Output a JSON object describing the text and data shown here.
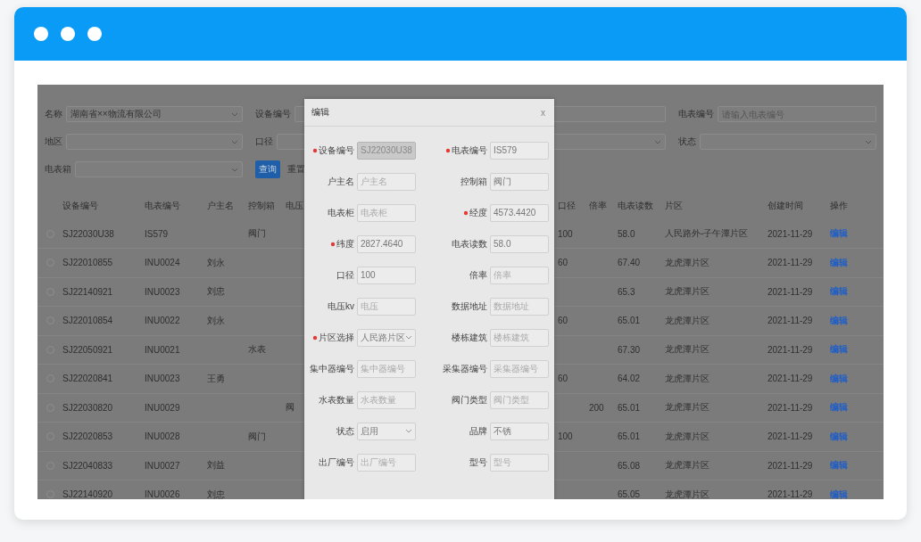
{
  "filters": [
    {
      "label": "名称",
      "kind": "select",
      "value": "湖南省××物流有限公司"
    },
    {
      "label": "设备编号",
      "kind": "input"
    },
    {
      "label": "电表编号",
      "kind": "input",
      "placeholder": "请输入电表编号"
    },
    {
      "label": "地区",
      "kind": "select"
    },
    {
      "label": "口径",
      "kind": "select"
    },
    {
      "label": "状态",
      "kind": "select"
    },
    {
      "label": "电表箱",
      "kind": "select"
    }
  ],
  "buttons": [
    {
      "label": "查询",
      "primary": true
    },
    {
      "label": "重置",
      "primary": false
    }
  ],
  "table": {
    "columns": [
      "设备编号",
      "电表编号",
      "户主名",
      "控制箱",
      "电压",
      "口径",
      "倍率",
      "电表读数",
      "片区",
      "创建时间",
      "操作"
    ],
    "rows": [
      {
        "selected": false,
        "cells": [
          "SJ22030U38",
          "IS579",
          "",
          "阀门",
          "",
          "100",
          "",
          "58.0",
          "人民路外-子午潭片区",
          "2021-11-29"
        ],
        "action": "编辑"
      },
      {
        "selected": false,
        "cells": [
          "SJ22010855",
          "INU0024",
          "刘永",
          "",
          "",
          "60",
          "",
          "67.40",
          "龙虎潭片区",
          "2021-11-29"
        ],
        "action": "编辑"
      },
      {
        "selected": false,
        "cells": [
          "SJ22140921",
          "INU0023",
          "刘忠",
          "",
          "",
          "",
          "",
          "65.3",
          "龙虎潭片区",
          "2021-11-29"
        ],
        "action": "编辑"
      },
      {
        "selected": false,
        "cells": [
          "SJ22010854",
          "INU0022",
          "刘永",
          "",
          "",
          "60",
          "",
          "65.01",
          "龙虎潭片区",
          "2021-11-29"
        ],
        "action": "编辑"
      },
      {
        "selected": false,
        "cells": [
          "SJ22050921",
          "INU0021",
          "",
          "水表",
          "",
          "",
          "",
          "67.30",
          "龙虎潭片区",
          "2021-11-29"
        ],
        "action": "编辑"
      },
      {
        "selected": false,
        "cells": [
          "SJ22020841",
          "INU0023",
          "王勇",
          "",
          "",
          "60",
          "",
          "64.02",
          "龙虎潭片区",
          "2021-11-29"
        ],
        "action": "编辑"
      },
      {
        "selected": false,
        "cells": [
          "SJ22030820",
          "INU0029",
          "",
          "",
          "阀",
          "",
          "200",
          "65.01",
          "龙虎潭片区",
          "2021-11-29"
        ],
        "action": "编辑"
      },
      {
        "selected": false,
        "cells": [
          "SJ22020853",
          "INU0028",
          "",
          "阀门",
          "",
          "100",
          "",
          "65.01",
          "龙虎潭片区",
          "2021-11-29"
        ],
        "action": "编辑"
      },
      {
        "selected": false,
        "cells": [
          "SJ22040833",
          "INU0027",
          "刘益",
          "",
          "",
          "",
          "",
          "65.08",
          "龙虎潭片区",
          "2021-11-29"
        ],
        "action": "编辑"
      },
      {
        "selected": false,
        "cells": [
          "SJ22140920",
          "INU0026",
          "刘忠",
          "",
          "",
          "",
          "",
          "65.05",
          "龙虎潭片区",
          "2021-11-29"
        ],
        "action": "编辑"
      }
    ]
  },
  "dialog": {
    "title": "编辑",
    "close": "x",
    "fields": [
      {
        "label": "设备编号",
        "kind": "input",
        "value": "SJ22030U38",
        "required": true,
        "disabled": true
      },
      {
        "label": "电表编号",
        "kind": "input",
        "value": "IS579",
        "required": true,
        "disabled": false
      },
      {
        "label": "户主名",
        "kind": "input",
        "placeholder": "户主名",
        "required": false,
        "disabled": false
      },
      {
        "label": "控制箱",
        "kind": "input",
        "value": "阀门",
        "required": false,
        "disabled": false
      },
      {
        "label": "电表柜",
        "kind": "input",
        "placeholder": "电表柜",
        "required": false,
        "disabled": false
      },
      {
        "label": "经度",
        "kind": "input",
        "value": "4573.4420",
        "required": true,
        "disabled": false
      },
      {
        "label": "纬度",
        "kind": "input",
        "value": "2827.4640",
        "required": true,
        "disabled": false
      },
      {
        "label": "电表读数",
        "kind": "input",
        "value": "58.0",
        "required": false,
        "disabled": false
      },
      {
        "label": "口径",
        "kind": "input",
        "value": "100",
        "required": false,
        "disabled": false
      },
      {
        "label": "倍率",
        "kind": "input",
        "placeholder": "倍率",
        "required": false,
        "disabled": false
      },
      {
        "label": "电压kv",
        "kind": "input",
        "placeholder": "电压",
        "required": false,
        "disabled": false
      },
      {
        "label": "数据地址",
        "kind": "input",
        "placeholder": "数据地址",
        "required": false,
        "disabled": false
      },
      {
        "label": "片区选择",
        "kind": "select",
        "value": "人民路片区",
        "required": true,
        "disabled": false
      },
      {
        "label": "楼栋建筑",
        "kind": "input",
        "placeholder": "楼栋建筑",
        "required": false,
        "disabled": false
      },
      {
        "label": "集中器编号",
        "kind": "input",
        "placeholder": "集中器编号",
        "required": false,
        "disabled": false
      },
      {
        "label": "采集器编号",
        "kind": "input",
        "placeholder": "采集器编号",
        "required": false,
        "disabled": false
      },
      {
        "label": "水表数量",
        "kind": "input",
        "placeholder": "水表数量",
        "required": false,
        "disabled": false
      },
      {
        "label": "阀门类型",
        "kind": "input",
        "placeholder": "阀门类型",
        "required": false,
        "disabled": false
      },
      {
        "label": "状态",
        "kind": "select",
        "value": "启用",
        "required": false,
        "disabled": false
      },
      {
        "label": "品牌",
        "kind": "input",
        "value": "不锈",
        "required": false,
        "disabled": false
      },
      {
        "label": "出厂编号",
        "kind": "input",
        "placeholder": "出厂编号",
        "required": false,
        "disabled": false
      },
      {
        "label": "型号",
        "kind": "input",
        "placeholder": "型号",
        "required": false,
        "disabled": false
      }
    ]
  }
}
